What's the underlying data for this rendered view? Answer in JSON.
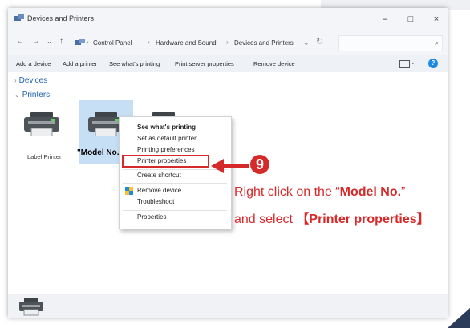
{
  "window": {
    "title": "Devices and Printers",
    "controls": {
      "minimize": "–",
      "maximize": "□",
      "close": "×"
    }
  },
  "nav": {
    "back": "←",
    "forward": "→",
    "recent": "⌄",
    "up": "↑",
    "breadcrumb": [
      "Control Panel",
      "Hardware and Sound",
      "Devices and Printers"
    ],
    "breadcrumb_sep": "›",
    "refresh": "↻",
    "search_icon": "⌕",
    "dropdown": "⌄"
  },
  "commands": [
    "Add a device",
    "Add a printer",
    "See what's printing",
    "Print server properties",
    "Remove device"
  ],
  "help_label": "?",
  "groups": {
    "devices": "Devices",
    "printers": "Printers",
    "expanded_arrow": "⌄",
    "collapsed_arrow": "›"
  },
  "printers": [
    {
      "label": "Label Printer"
    },
    {
      "label": "\"Model No.\""
    }
  ],
  "context_menu": {
    "items": [
      {
        "label": "See what's printing",
        "bold": true
      },
      {
        "label": "Set as default printer"
      },
      {
        "label": "Printing preferences"
      },
      {
        "label": "Printer properties",
        "highlighted": true
      },
      {
        "label": "Create shortcut"
      },
      {
        "label": "Remove device",
        "icon": "shield-icon"
      },
      {
        "label": "Troubleshoot"
      },
      {
        "label": "Properties"
      }
    ]
  },
  "callout": {
    "step": "9",
    "line1_prefix": "Right click on the “",
    "line1_bold": "Model No.",
    "line1_suffix": "”",
    "line2_prefix": "and select ",
    "line2_bold": "【Printer properties】"
  },
  "colors": {
    "accent_red": "#d62a2a",
    "link_blue": "#1c62b0",
    "selection": "#c7dff4"
  }
}
